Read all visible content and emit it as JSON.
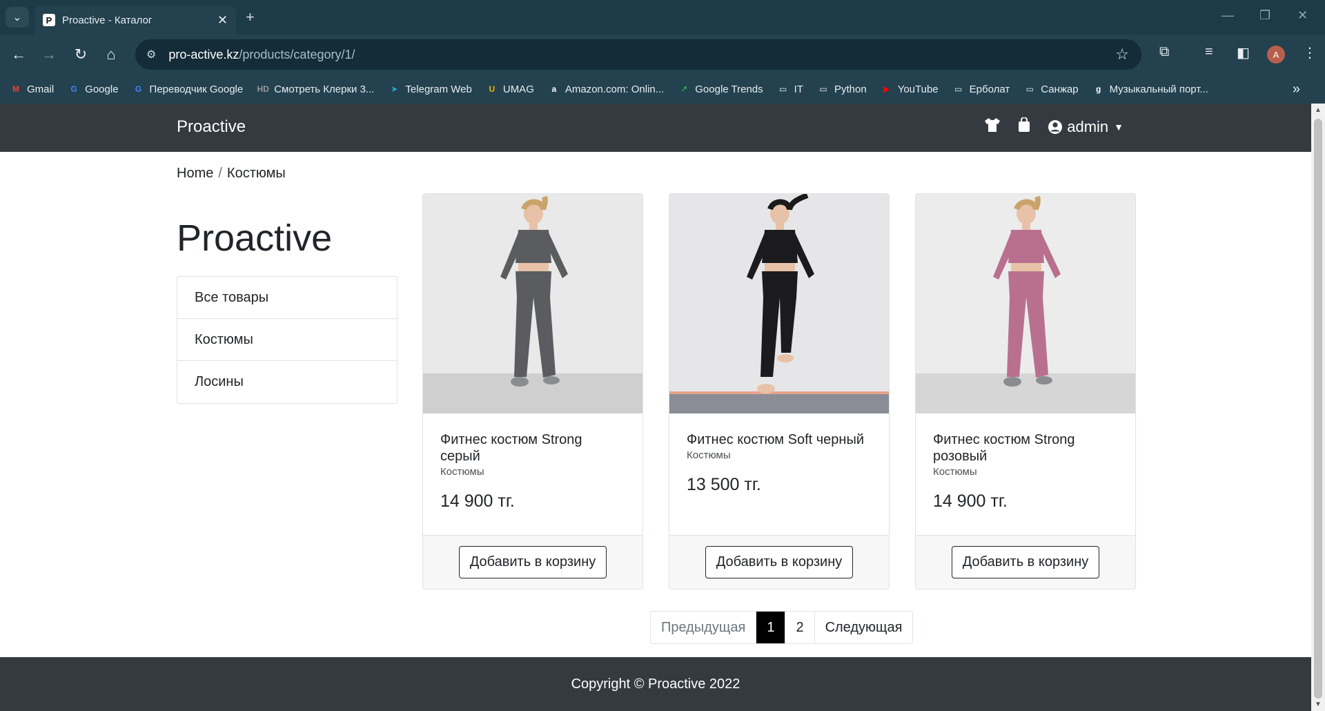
{
  "browser": {
    "tab_title": "Proactive - Каталог",
    "tab_favicon": "P",
    "url_host": "pro-active.kz",
    "url_path": "/products/category/1/",
    "profile_initial": "A",
    "bookmarks": [
      {
        "label": "Gmail",
        "icon": "gmail-icon",
        "glyph": "M",
        "color": "#ea4335"
      },
      {
        "label": "Google",
        "icon": "google-icon",
        "glyph": "G",
        "color": "#4285f4"
      },
      {
        "label": "Переводчик Google",
        "icon": "translate-icon",
        "glyph": "G",
        "color": "#4285f4"
      },
      {
        "label": "Смотреть Клерки 3...",
        "icon": "hd-icon",
        "glyph": "HD",
        "color": "#999999"
      },
      {
        "label": "Telegram Web",
        "icon": "telegram-icon",
        "glyph": "➤",
        "color": "#2aa3e0"
      },
      {
        "label": "UMAG",
        "icon": "umag-icon",
        "glyph": "U",
        "color": "#f4b400"
      },
      {
        "label": "Amazon.com: Onlin...",
        "icon": "amazon-icon",
        "glyph": "a",
        "color": "#ffffff"
      },
      {
        "label": "Google Trends",
        "icon": "trends-icon",
        "glyph": "↗",
        "color": "#34a853"
      },
      {
        "label": "IT",
        "icon": "folder-icon",
        "glyph": "▭",
        "color": "#e8eef1"
      },
      {
        "label": "Python",
        "icon": "folder-icon",
        "glyph": "▭",
        "color": "#e8eef1"
      },
      {
        "label": "YouTube",
        "icon": "youtube-icon",
        "glyph": "▶",
        "color": "#ff0000"
      },
      {
        "label": "Ерболат",
        "icon": "folder-icon",
        "glyph": "▭",
        "color": "#e8eef1"
      },
      {
        "label": "Санжар",
        "icon": "folder-icon",
        "glyph": "▭",
        "color": "#e8eef1"
      },
      {
        "label": "Музыкальный порт...",
        "icon": "music-portal-icon",
        "glyph": "g",
        "color": "#ffffff"
      }
    ]
  },
  "site": {
    "brand": "Proactive",
    "user": "admin",
    "breadcrumb": {
      "home": "Home",
      "separator": "/",
      "current": "Костюмы"
    },
    "sidebar_title": "Proactive",
    "categories": [
      "Все товары",
      "Костюмы",
      "Лосины"
    ],
    "products": [
      {
        "name": "Фитнес костюм Strong серый",
        "category": "Костюмы",
        "price": "14 900 тг.",
        "button": "Добавить в корзину",
        "suit_color": "#5a5c60",
        "bg": "#e9e9e9",
        "floor": "#cfcfcf"
      },
      {
        "name": "Фитнес костюм Soft черный",
        "category": "Костюмы",
        "price": "13 500 тг.",
        "button": "Добавить в корзину",
        "suit_color": "#1b1b1d",
        "bg": "#e6e6e8",
        "floor": "#8a8d96"
      },
      {
        "name": "Фитнес костюм Strong розовый",
        "category": "Костюмы",
        "price": "14 900 тг.",
        "button": "Добавить в корзину",
        "suit_color": "#b9708f",
        "bg": "#ececec",
        "floor": "#d6d6d6"
      }
    ],
    "pagination": {
      "prev": "Предыдущая",
      "pages": [
        "1",
        "2"
      ],
      "active": "1",
      "next": "Следующая"
    },
    "footer": "Copyright © Proactive 2022"
  }
}
